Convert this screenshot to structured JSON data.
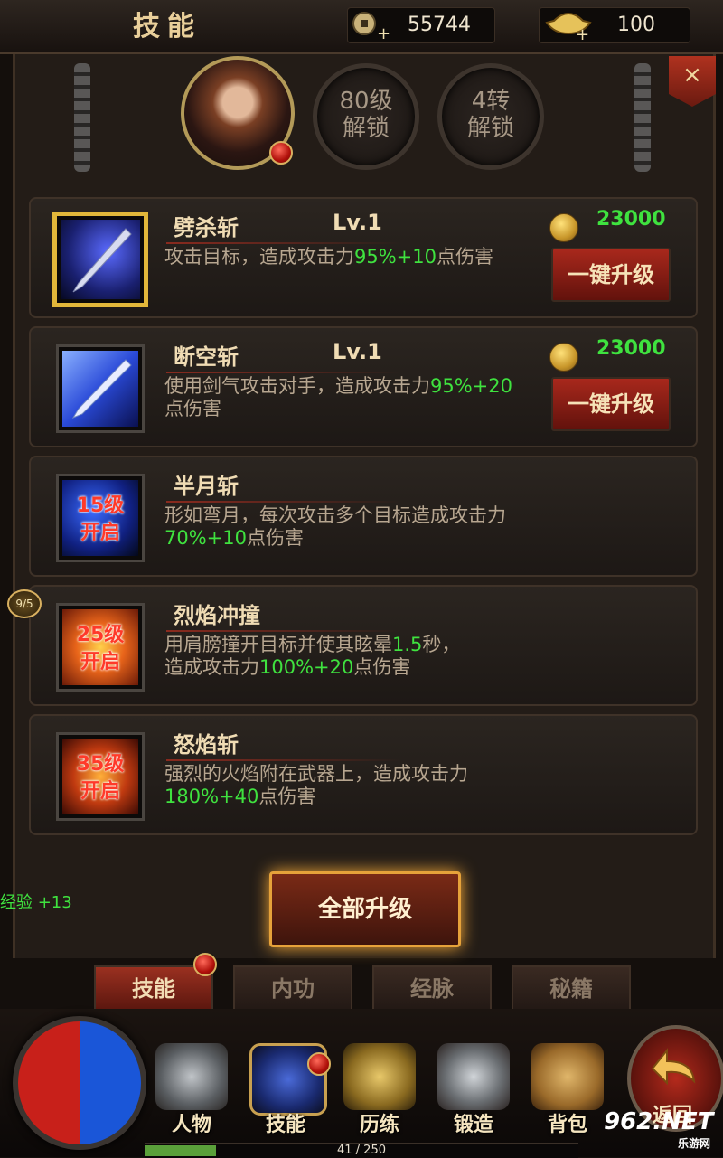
{
  "header": {
    "title": "技能",
    "copper": "55744",
    "gold": "100"
  },
  "unlock_rings": [
    {
      "line1": "80级",
      "line2": "解锁"
    },
    {
      "line1": "4转",
      "line2": "解锁"
    }
  ],
  "close_label": "×",
  "skills": [
    {
      "name": "劈杀斩",
      "level": "Lv.1",
      "desc_a": "攻击目标，造成攻击力",
      "desc_hl": "95%+10",
      "desc_b": "点伤害",
      "cost": "23000",
      "button": "一键升级"
    },
    {
      "name": "断空斩",
      "level": "Lv.1",
      "desc_a": "使用剑气攻击对手，造成攻击力",
      "desc_hl": "95%+20",
      "desc_b": "点伤害",
      "cost": "23000",
      "button": "一键升级"
    },
    {
      "name": "半月斩",
      "lock": [
        "15级",
        "开启"
      ],
      "desc_a": "形如弯月，每次攻击多个目标造成攻击力",
      "desc_hl": "70%+10",
      "desc_b": "点伤害"
    },
    {
      "name": "烈焰冲撞",
      "lock": [
        "25级",
        "开启"
      ],
      "desc_a": "用肩膀撞开目标并使其眩晕",
      "desc_hl": "1.5",
      "desc_b": "秒，",
      "desc_a2": "造成攻击力",
      "desc_hl2": "100%+20",
      "desc_b2": "点伤害"
    },
    {
      "name": "怒焰斩",
      "lock": [
        "35级",
        "开启"
      ],
      "desc_a": "强烈的火焰附在武器上，造成攻击力",
      "desc_hl": "180%+40",
      "desc_b": "点伤害"
    }
  ],
  "side_badge": "9/5",
  "exp_text": "经验 +13",
  "all_upgrade": "全部升级",
  "tabs": [
    "技能",
    "内功",
    "经脉",
    "秘籍"
  ],
  "dock": [
    "人物",
    "技能",
    "历练",
    "锻造",
    "背包"
  ],
  "back_label": "返回",
  "progress": {
    "text": "41 / 250",
    "current": 41,
    "max": 250
  },
  "watermark": {
    "main": "962.NET",
    "sub": "乐游网"
  },
  "colors": {
    "highlight": "#3fe23f",
    "accent_gold": "#e2b73a",
    "button_red": "#a8281c"
  }
}
